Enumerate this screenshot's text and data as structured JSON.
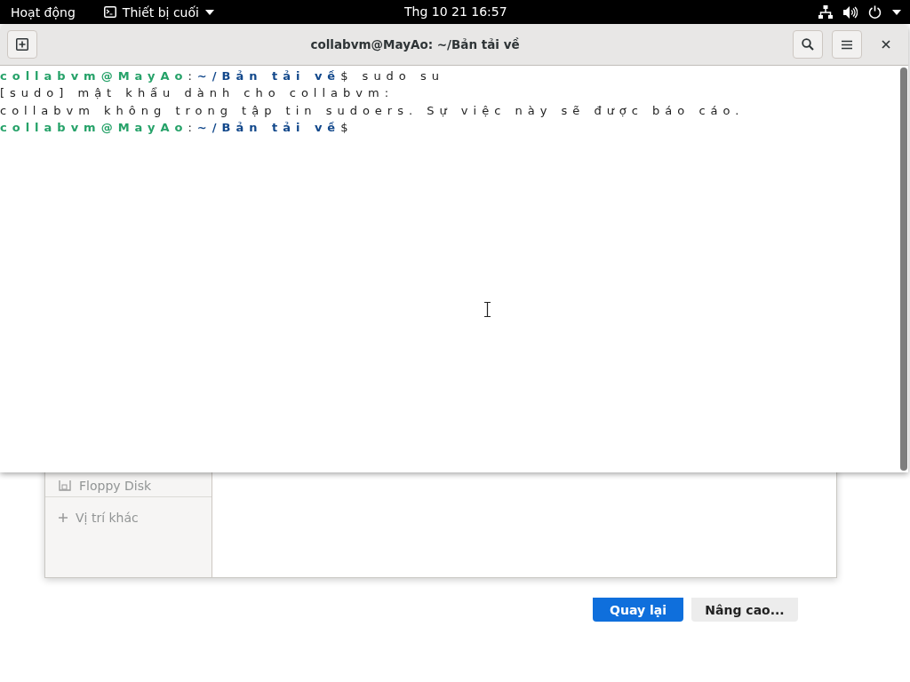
{
  "top_bar": {
    "activities": "Hoạt động",
    "app_menu": "Thiết bị cuối",
    "clock": "Thg 10 21  16:57"
  },
  "background_dialog": {
    "sidebar_items": [
      {
        "kind": "drive",
        "label": "Floppy Disk"
      },
      {
        "kind": "other",
        "label": "Vị trí khác"
      }
    ],
    "buttons": [
      {
        "label": "Quay lại",
        "kind": "primary"
      },
      {
        "label": "Nâng cao...",
        "kind": "normal"
      }
    ]
  },
  "terminal": {
    "title": "collabvm@MayAo: ~/Bản tải về",
    "lines": [
      [
        {
          "kind": "user",
          "text": "collabvm@MayAo"
        },
        {
          "kind": "plain",
          "text": ":"
        },
        {
          "kind": "path",
          "text": "~/Bản tải về"
        },
        {
          "kind": "plain",
          "text": "$ sudo su"
        }
      ],
      [
        {
          "kind": "plain",
          "text": "[sudo] mật khẩu dành cho collabvm:"
        }
      ],
      [
        {
          "kind": "plain",
          "text": "collabvm không trong tập tin sudoers. Sự việc này sẽ được báo cáo."
        }
      ],
      [
        {
          "kind": "user",
          "text": "collabvm@MayAo"
        },
        {
          "kind": "plain",
          "text": ":"
        },
        {
          "kind": "path",
          "text": "~/Bản tải về"
        },
        {
          "kind": "plain",
          "text": "$"
        }
      ]
    ]
  }
}
